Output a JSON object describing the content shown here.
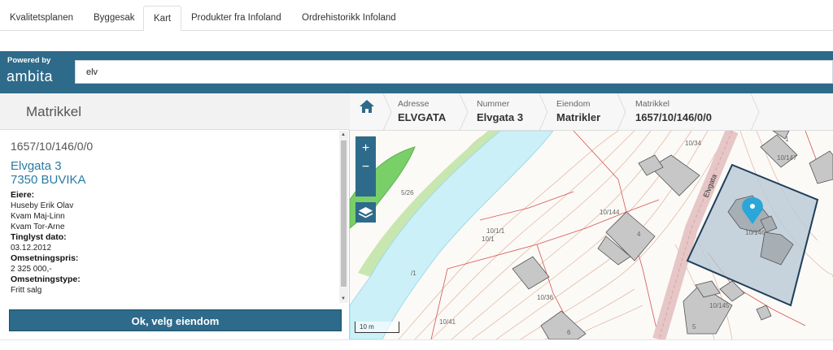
{
  "tabs": [
    {
      "label": "Kvalitetsplanen",
      "active": false
    },
    {
      "label": "Byggesak",
      "active": false
    },
    {
      "label": "Kart",
      "active": true
    },
    {
      "label": "Produkter fra Infoland",
      "active": false
    },
    {
      "label": "Ordrehistorikk Infoland",
      "active": false
    }
  ],
  "ambita": {
    "powered_by": "Powered by",
    "brand": "ambita",
    "search_value": "elv"
  },
  "panel": {
    "title": "Matrikkel",
    "matrikkel_id": "1657/10/146/0/0",
    "address_line1": "Elvgata 3",
    "address_line2": "7350 BUVIKA",
    "owners_label": "Eiere:",
    "owners": [
      "Huseby Erik Olav",
      "Kvam Maj-Linn",
      "Kvam Tor-Arne"
    ],
    "tinglyst_label": "Tinglyst dato:",
    "tinglyst_value": "03.12.2012",
    "omsetningspris_label": "Omsetningspris:",
    "omsetningspris_value": "2 325 000,-",
    "omsetningstype_label": "Omsetningstype:",
    "omsetningstype_value": "Fritt salg",
    "ok_button": "Ok, velg eiendom"
  },
  "breadcrumb": [
    {
      "label": "Adresse",
      "value": "ELVGATA"
    },
    {
      "label": "Nummer",
      "value": "Elvgata 3"
    },
    {
      "label": "Eiendom",
      "value": "Matrikler"
    },
    {
      "label": "Matrikkel",
      "value": "1657/10/146/0/0"
    }
  ],
  "map": {
    "zoom_in": "+",
    "zoom_out": "−",
    "scale": "10 m",
    "street_name": "Elvgata",
    "labels": [
      "5/26",
      "10/1/1",
      "10/1",
      "/1",
      "10/36",
      "10/41",
      "10/144",
      "4",
      "10/34",
      "1",
      "10/147",
      "10/146",
      "10/145",
      "5",
      "6"
    ],
    "colors": {
      "river": "#ccf0f7",
      "park": "#79cf68",
      "parcel_fill": "#b9c9d6",
      "parcel_border": "#1e3d5a",
      "pin": "#2aa6d9"
    }
  }
}
